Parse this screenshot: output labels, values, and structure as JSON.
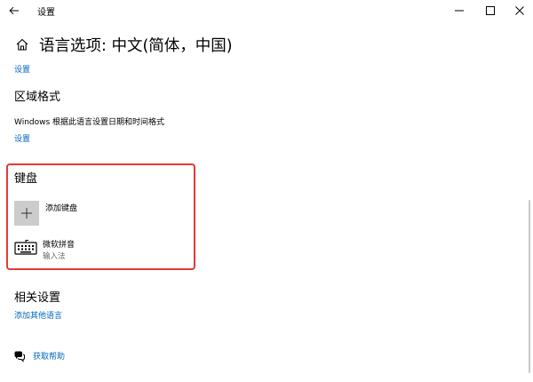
{
  "window": {
    "app_title": "设置"
  },
  "header": {
    "title": "语言选项: 中文(简体，中国)"
  },
  "top_section": {
    "settings_link": "设置"
  },
  "region_format": {
    "heading": "区域格式",
    "description": "Windows 根据此语言设置日期和时间格式",
    "settings_link": "设置"
  },
  "keyboard": {
    "heading": "键盘",
    "add_label": "添加键盘",
    "items": [
      {
        "name": "微软拼音",
        "type": "输入法"
      }
    ]
  },
  "related": {
    "heading": "相关设置",
    "add_language_link": "添加其他语言"
  },
  "help": {
    "label": "获取帮助"
  },
  "colors": {
    "link": "#0067c0",
    "highlight_border": "#e53935",
    "tile_bg": "#cccccc"
  },
  "icons": [
    "back-arrow-icon",
    "home-icon",
    "minimize-icon",
    "maximize-icon",
    "close-icon",
    "plus-icon",
    "keyboard-icon",
    "help-chat-icon"
  ]
}
